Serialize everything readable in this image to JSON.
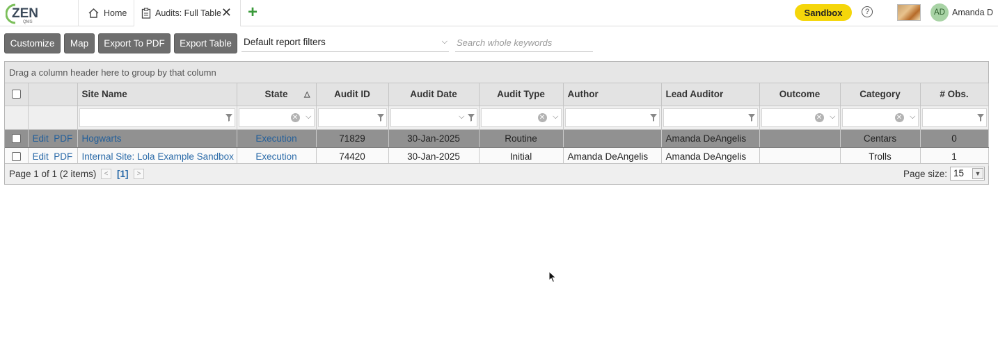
{
  "app": {
    "logo_text": "ZEN",
    "logo_sub": "QMS",
    "tabs": [
      {
        "label": "Home",
        "icon": "home-icon"
      },
      {
        "label": "Audits: Full Table",
        "icon": "clipboard-icon"
      }
    ],
    "environment_badge": "Sandbox",
    "user": {
      "initials": "AD",
      "name": "Amanda D"
    }
  },
  "toolbar": {
    "customize_label": "Customize",
    "map_label": "Map",
    "export_pdf_label": "Export To PDF",
    "export_table_label": "Export Table",
    "report_filter_value": "Default report filters",
    "search_placeholder": "Search whole keywords"
  },
  "grid": {
    "group_panel_text": "Drag a column header here to group by that column",
    "columns": [
      "Site Name",
      "State",
      "Audit ID",
      "Audit Date",
      "Audit Type",
      "Author",
      "Lead Auditor",
      "Outcome",
      "Category",
      "# Obs."
    ],
    "sorted_column": "State",
    "row_actions": {
      "edit": "Edit",
      "pdf": "PDF"
    },
    "rows": [
      {
        "site_name": "Hogwarts",
        "state": "Execution",
        "audit_id": "71829",
        "audit_date": "30-Jan-2025",
        "audit_type": "Routine",
        "author": "",
        "lead_auditor": "Amanda DeAngelis",
        "outcome": "",
        "category": "Centars",
        "obs": "0"
      },
      {
        "site_name": "Internal Site: Lola Example Sandbox",
        "state": "Execution",
        "audit_id": "74420",
        "audit_date": "30-Jan-2025",
        "audit_type": "Initial",
        "author": "Amanda DeAngelis",
        "lead_auditor": "Amanda DeAngelis",
        "outcome": "",
        "category": "Trolls",
        "obs": "1"
      }
    ],
    "pager": {
      "info": "Page 1 of 1 (2 items)",
      "current_page": "[1]",
      "page_size_label": "Page size:",
      "page_size": "15"
    }
  },
  "colors": {
    "accent": "#2a6aa8",
    "badge": "#f5d60a",
    "button": "#6e6e6e",
    "selected_row": "#919191"
  }
}
